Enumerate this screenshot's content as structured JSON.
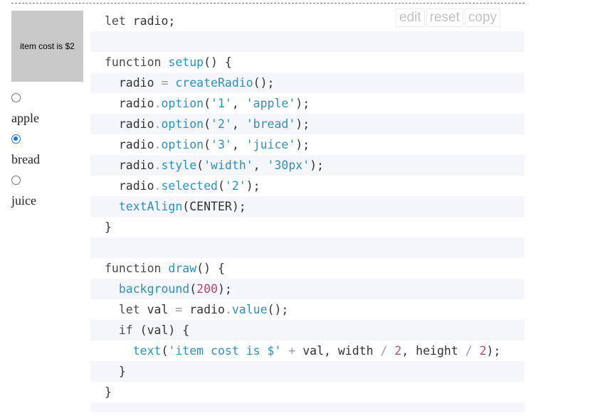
{
  "canvas": {
    "text": "item cost is $2",
    "background": "#c8c8c8"
  },
  "radio": {
    "options": [
      {
        "label": "apple",
        "checked": false
      },
      {
        "label": "bread",
        "checked": true
      },
      {
        "label": "juice",
        "checked": false
      }
    ]
  },
  "toolbar": {
    "edit": "edit",
    "reset": "reset",
    "copy": "copy"
  },
  "code": {
    "lines": [
      "let radio;",
      "",
      "function setup() {",
      "  radio = createRadio();",
      "  radio.option('1', 'apple');",
      "  radio.option('2', 'bread');",
      "  radio.option('3', 'juice');",
      "  radio.style('width', '30px');",
      "  radio.selected('2');",
      "  textAlign(CENTER);",
      "}",
      "",
      "function draw() {",
      "  background(200);",
      "  let val = radio.value();",
      "  if (val) {",
      "    text('item cost is $' + val, width / 2, height / 2);",
      "  }",
      "}"
    ]
  },
  "colors": {
    "accent": "#1a73e8",
    "code_fn": "#2d8fbf",
    "code_num": "#c0476b",
    "stripe": "#f4f6fb"
  }
}
